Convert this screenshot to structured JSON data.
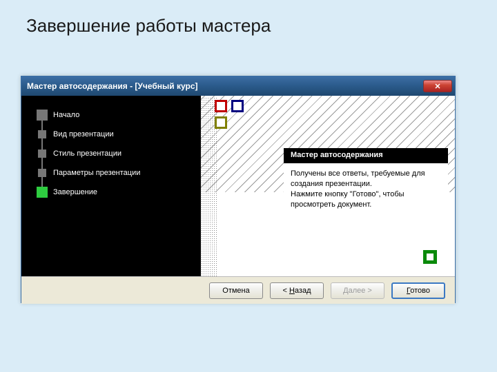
{
  "slide_title": "Завершение работы мастера",
  "window": {
    "title": "Мастер автосодержания - [Учебный курс]"
  },
  "steps": [
    {
      "label": "Начало"
    },
    {
      "label": "Вид презентации"
    },
    {
      "label": "Стиль презентации"
    },
    {
      "label": "Параметры презентации"
    },
    {
      "label": "Завершение"
    }
  ],
  "panel": {
    "header": "Мастер автосодержания",
    "line1": "Получены все ответы, требуемые для создания презентации.",
    "line2": "Нажмите кнопку \"Готово\", чтобы просмотреть документ."
  },
  "buttons": {
    "cancel": "Отмена",
    "back_prefix": "< ",
    "back_u": "Н",
    "back_rest": "азад",
    "next_u": "Д",
    "next_rest": "алее >",
    "finish_u": "Г",
    "finish_rest": "отово"
  },
  "colors": {
    "deco_red": "#c00000",
    "deco_blue": "#000080",
    "deco_olive": "#808000"
  }
}
